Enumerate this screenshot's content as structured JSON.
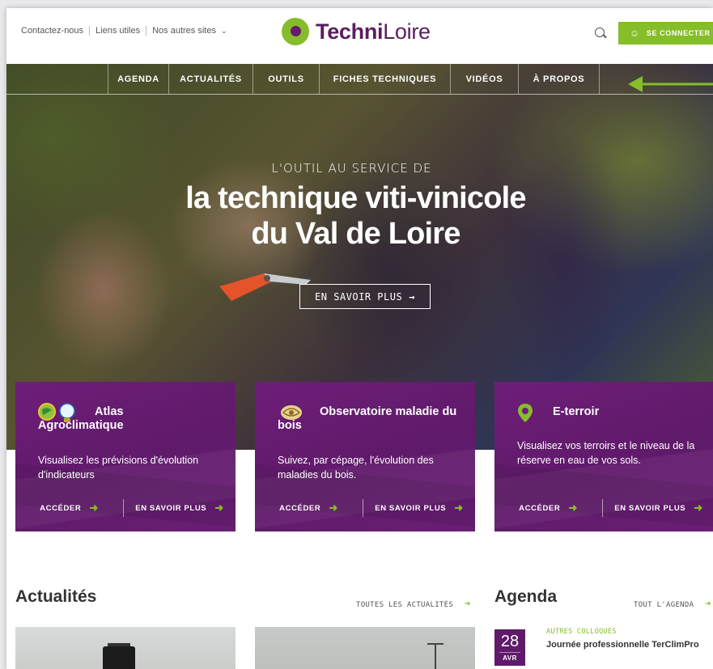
{
  "header": {
    "top_links": [
      "Contactez-nous",
      "Liens utiles",
      "Nos autres sites"
    ],
    "logo_part1": "Techni",
    "logo_part2": "Loire",
    "login_label": "SE CONNECTER"
  },
  "nav": {
    "items": [
      "AGENDA",
      "ACTUALITÉS",
      "OUTILS",
      "FICHES TECHNIQUES",
      "VIDÉOS",
      "À PROPOS"
    ]
  },
  "hero": {
    "kicker": "L'OUTIL AU SERVICE DE",
    "title_line1": "la technique viti-vinicole",
    "title_line2": "du Val de Loire",
    "cta_label": "EN SAVOIR PLUS"
  },
  "cards": [
    {
      "title": "Atlas Agroclimatique",
      "description": "Visualisez les prévisions d'évolution d'indicateurs",
      "access_label": "ACCÉDER",
      "more_label": "EN SAVOIR PLUS"
    },
    {
      "title": "Observatoire maladie du bois",
      "description": "Suivez, par cépage, l'évolution des maladies du bois.",
      "access_label": "ACCÉDER",
      "more_label": "EN SAVOIR PLUS"
    },
    {
      "title": "E-terroir",
      "description": "Visualisez vos terroirs et le niveau de la réserve en eau de vos sols.",
      "access_label": "ACCÉDER",
      "more_label": "EN SAVOIR PLUS"
    }
  ],
  "news": {
    "title": "Actualités",
    "all_link": "TOUTES LES ACTUALITÉS"
  },
  "agenda": {
    "title": "Agenda",
    "all_link": "TOUT L'AGENDA",
    "events": [
      {
        "day": "28",
        "month": "AVR",
        "category": "AUTRES COLLOQUES",
        "title": "Journée professionnelle TerClimPro"
      }
    ]
  },
  "colors": {
    "brand_purple": "#5f1a6a",
    "accent_green": "#86bd2a"
  }
}
